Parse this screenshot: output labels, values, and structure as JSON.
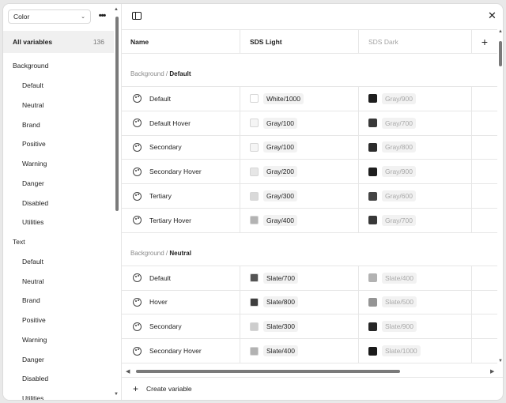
{
  "sidebar": {
    "mode_select": "Color",
    "all_variables": {
      "label": "All variables",
      "count": "136"
    },
    "items": [
      {
        "label": "Background",
        "type": "group"
      },
      {
        "label": "Default",
        "type": "child"
      },
      {
        "label": "Neutral",
        "type": "child"
      },
      {
        "label": "Brand",
        "type": "child"
      },
      {
        "label": "Positive",
        "type": "child"
      },
      {
        "label": "Warning",
        "type": "child"
      },
      {
        "label": "Danger",
        "type": "child"
      },
      {
        "label": "Disabled",
        "type": "child"
      },
      {
        "label": "Utilities",
        "type": "child"
      },
      {
        "label": "Text",
        "type": "group"
      },
      {
        "label": "Default",
        "type": "child"
      },
      {
        "label": "Neutral",
        "type": "child"
      },
      {
        "label": "Brand",
        "type": "child"
      },
      {
        "label": "Positive",
        "type": "child"
      },
      {
        "label": "Warning",
        "type": "child"
      },
      {
        "label": "Danger",
        "type": "child"
      },
      {
        "label": "Disabled",
        "type": "child"
      },
      {
        "label": "Utilities",
        "type": "child"
      }
    ]
  },
  "table": {
    "columns": {
      "name": "Name",
      "light": "SDS Light",
      "dark": "SDS Dark",
      "add": "+"
    },
    "groups": [
      {
        "prefix": "Background /",
        "name": "Default",
        "rows": [
          {
            "name": "Default",
            "light": "White/1000",
            "light_color": "#ffffff",
            "dark": "Gray/900",
            "dark_color": "#1e1e1e"
          },
          {
            "name": "Default Hover",
            "light": "Gray/100",
            "light_color": "#f5f5f5",
            "dark": "Gray/700",
            "dark_color": "#383838"
          },
          {
            "name": "Secondary",
            "light": "Gray/100",
            "light_color": "#f5f5f5",
            "dark": "Gray/800",
            "dark_color": "#2c2c2c"
          },
          {
            "name": "Secondary Hover",
            "light": "Gray/200",
            "light_color": "#e6e6e6",
            "dark": "Gray/900",
            "dark_color": "#1e1e1e"
          },
          {
            "name": "Tertiary",
            "light": "Gray/300",
            "light_color": "#d9d9d9",
            "dark": "Gray/600",
            "dark_color": "#444444"
          },
          {
            "name": "Tertiary Hover",
            "light": "Gray/400",
            "light_color": "#b3b3b3",
            "dark": "Gray/700",
            "dark_color": "#383838"
          }
        ]
      },
      {
        "prefix": "Background /",
        "name": "Neutral",
        "rows": [
          {
            "name": "Default",
            "light": "Slate/700",
            "light_color": "#545454",
            "dark": "Slate/400",
            "dark_color": "#b2b2b2"
          },
          {
            "name": "Hover",
            "light": "Slate/800",
            "light_color": "#3e3e3e",
            "dark": "Slate/500",
            "dark_color": "#949494"
          },
          {
            "name": "Secondary",
            "light": "Slate/300",
            "light_color": "#cdcdcd",
            "dark": "Slate/900",
            "dark_color": "#262626"
          },
          {
            "name": "Secondary Hover",
            "light": "Slate/400",
            "light_color": "#b2b2b2",
            "dark": "Slate/1000",
            "dark_color": "#1a1a1a"
          }
        ]
      }
    ]
  },
  "footer": {
    "create_label": "Create variable"
  },
  "icons": {
    "panel": "panel-toggle-icon",
    "close": "close-icon",
    "palette": "palette-icon",
    "plus": "plus-icon",
    "more": "more-icon",
    "chevron": "chevron-down-icon"
  }
}
